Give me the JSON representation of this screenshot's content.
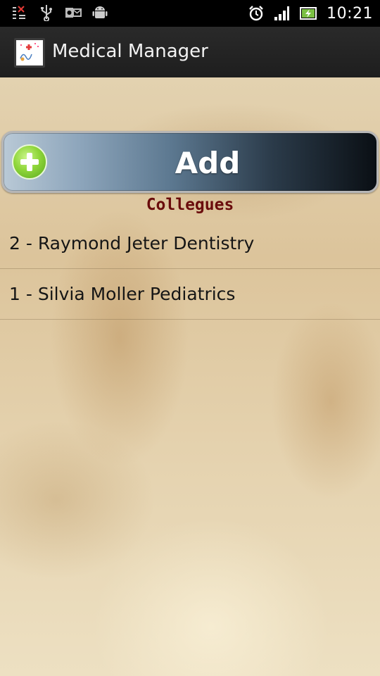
{
  "status_bar": {
    "time": "10:21",
    "left_icons": [
      "task-switcher-icon",
      "usb-icon",
      "outlook-icon",
      "android-icon"
    ],
    "right_icons": [
      "alarm-icon",
      "signal-icon",
      "battery-charging-icon"
    ]
  },
  "action_bar": {
    "title": "Medical Manager",
    "icon": "medical-manager-app-icon"
  },
  "add_button": {
    "label": "Add",
    "icon": "plus-icon"
  },
  "section": {
    "title": "Collegues"
  },
  "colleagues": [
    {
      "label": "2 - Raymond Jeter Dentistry"
    },
    {
      "label": "1 - Silvia Moller Pediatrics"
    }
  ],
  "colors": {
    "title_red": "#6a0c0c",
    "action_bar": "#222222",
    "add_green": "#8fd63a"
  }
}
